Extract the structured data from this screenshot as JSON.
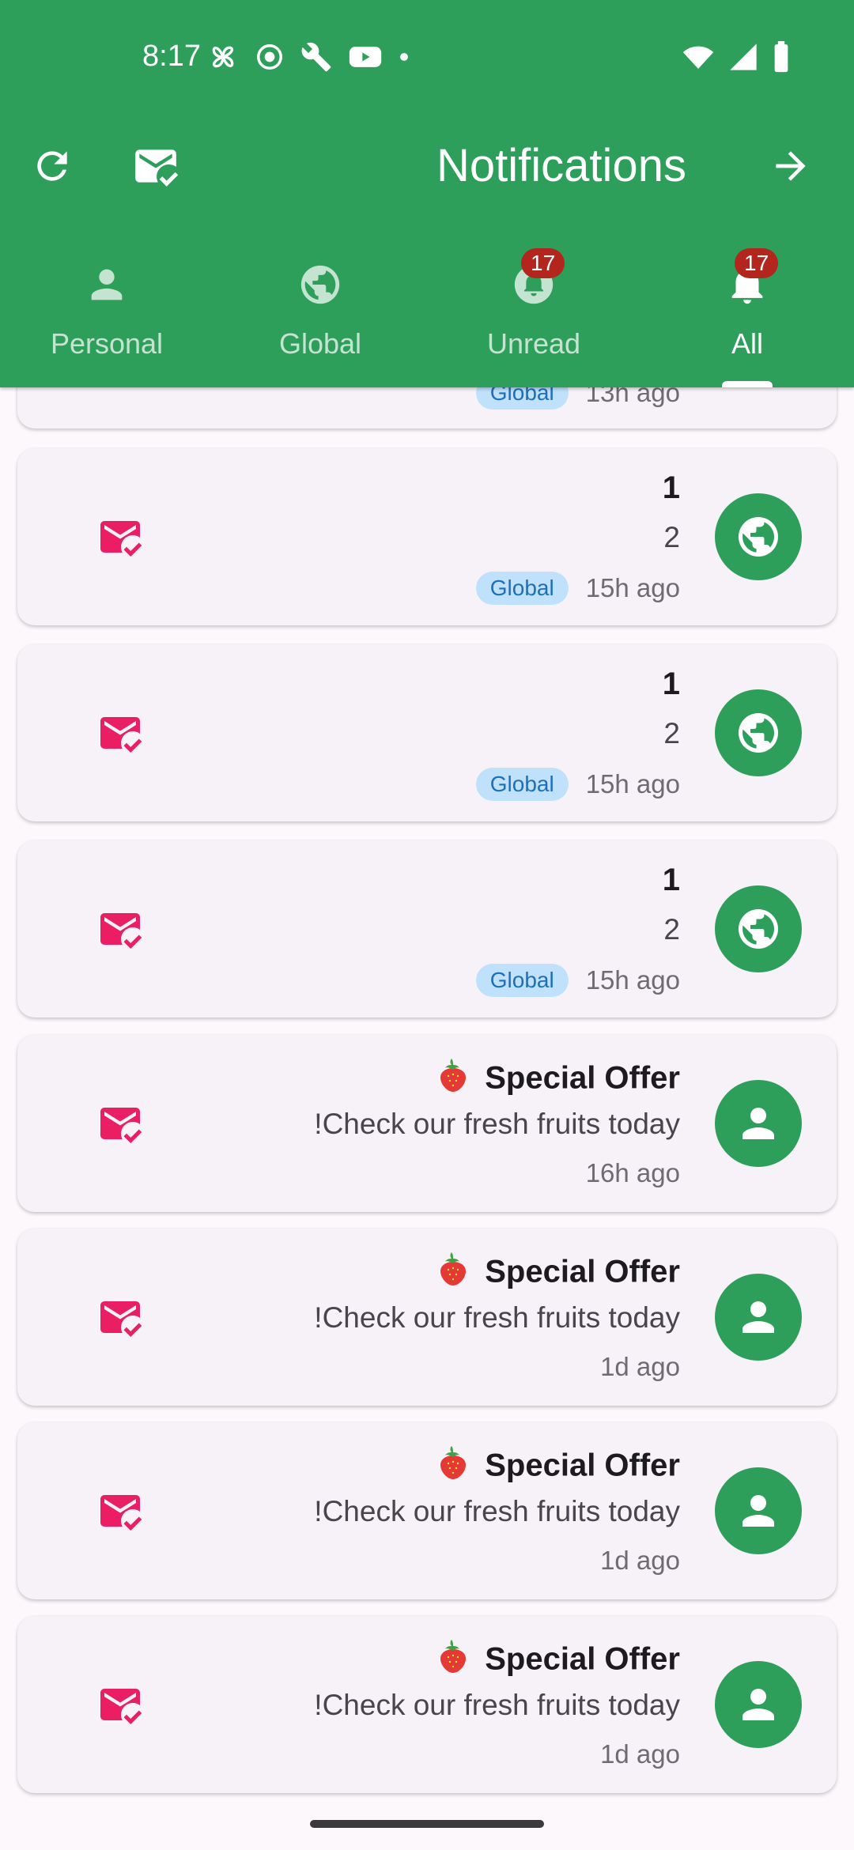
{
  "status_bar": {
    "time": "8:17"
  },
  "app_bar": {
    "title": "Notifications"
  },
  "tabs": [
    {
      "label": "Personal",
      "badge": ""
    },
    {
      "label": "Global",
      "badge": ""
    },
    {
      "label": "Unread",
      "badge": "17"
    },
    {
      "label": "All",
      "badge": "17"
    }
  ],
  "partial_card": {
    "chip": "Global",
    "time": "13h ago"
  },
  "notifications": [
    {
      "title": "1",
      "body": "2",
      "chip": "Global",
      "time": "15h ago",
      "type": "globe-icon"
    },
    {
      "title": "1",
      "body": "2",
      "chip": "Global",
      "time": "15h ago",
      "type": "globe-icon"
    },
    {
      "title": "1",
      "body": "2",
      "chip": "Global",
      "time": "15h ago",
      "type": "globe-icon"
    },
    {
      "title": "Special Offer",
      "body": "!Check our fresh fruits today",
      "time": "16h ago",
      "type": "person-icon"
    },
    {
      "title": "Special Offer",
      "body": "!Check our fresh fruits today",
      "time": "1d ago",
      "type": "person-icon"
    },
    {
      "title": "Special Offer",
      "body": "!Check our fresh fruits today",
      "time": "1d ago",
      "type": "person-icon"
    },
    {
      "title": "Special Offer",
      "body": "!Check our fresh fruits today",
      "time": "1d ago",
      "type": "person-icon"
    }
  ],
  "colors": {
    "primary": "#2e9e5b",
    "mail_icon": "#e91e63",
    "badge": "#b3261e",
    "chip_bg": "#bfe1fb",
    "chip_text": "#1d6fb8"
  }
}
